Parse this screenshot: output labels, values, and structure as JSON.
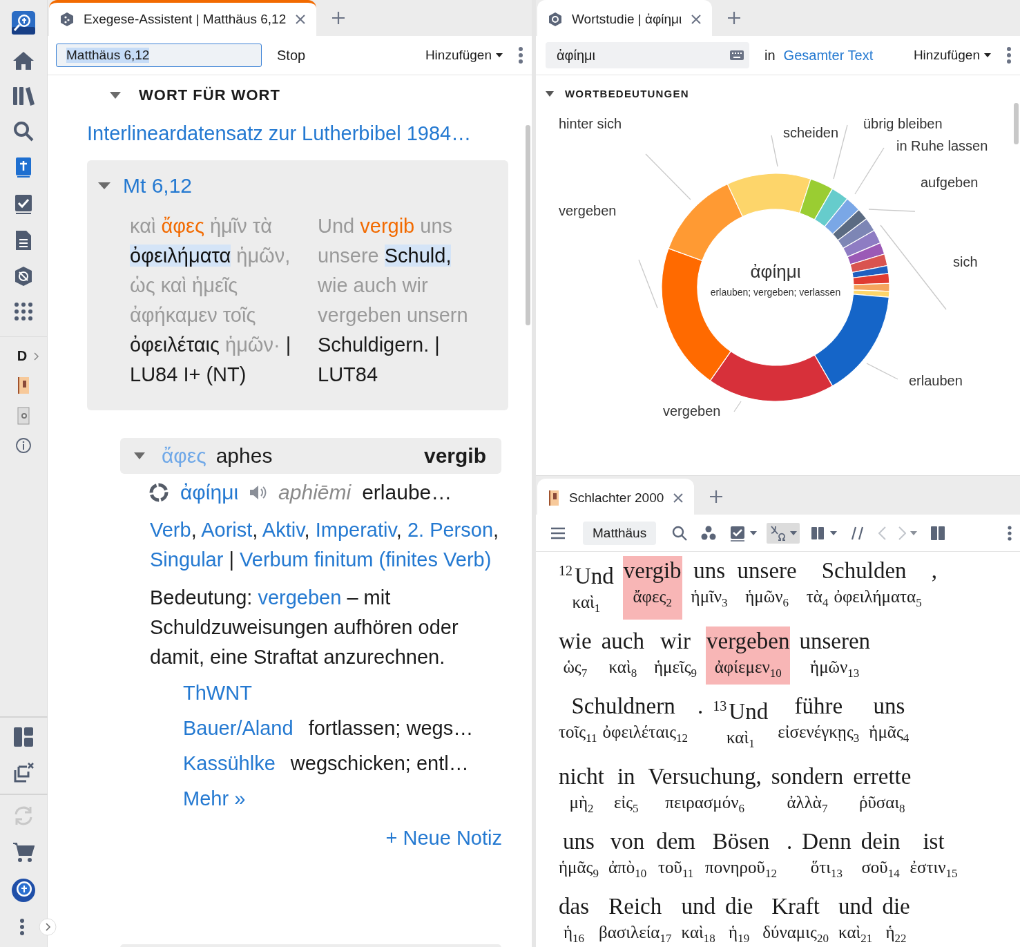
{
  "rail": {
    "letter": "D"
  },
  "left": {
    "tab": {
      "title": "Exegese-Assistent | Matthäus 6,12",
      "focused": true
    },
    "reference": "Matthäus 6,12",
    "stop": "Stop",
    "add": "Hinzufügen",
    "section": {
      "title": "WORT FÜR WORT",
      "expanded": true
    },
    "dataset_link": "Interlineardatensatz zur Lutherbibel 1984…",
    "verse": {
      "ref": "Mt 6,12",
      "expanded": true,
      "greek": [
        {
          "t": "καὶ",
          "kind": "muted"
        },
        {
          "t": "ἄφες",
          "kind": "focus"
        },
        {
          "t": "ἡμῖν",
          "kind": "muted"
        },
        {
          "t": "τὰ",
          "kind": "muted"
        },
        {
          "t": "ὀφειλήματα",
          "kind": "match"
        },
        {
          "t": "ἡμῶν,",
          "kind": "muted"
        },
        {
          "t": "ὡς",
          "kind": "muted"
        },
        {
          "t": "καὶ",
          "kind": "muted"
        },
        {
          "t": "ἡμεῖς",
          "kind": "muted"
        },
        {
          "t": "ἀφήκαμεν",
          "kind": "muted"
        },
        {
          "t": "τοῖς",
          "kind": "muted"
        },
        {
          "t": "ὀφειλέταις",
          "kind": "normal"
        },
        {
          "t": "ἡμῶν·",
          "kind": "muted"
        },
        {
          "t": "| LU84 I+ (NT)",
          "kind": "normal"
        }
      ],
      "german": [
        {
          "t": "Und",
          "kind": "muted"
        },
        {
          "t": "vergib",
          "kind": "focus"
        },
        {
          "t": "uns",
          "kind": "muted"
        },
        {
          "t": "unsere",
          "kind": "muted"
        },
        {
          "t": "Schuld,",
          "kind": "match"
        },
        {
          "t": "wie auch wir vergeben unsern",
          "kind": "muted"
        },
        {
          "t": "Schuldigern. | LUT84",
          "kind": "normal"
        }
      ]
    },
    "word": {
      "greek": "ἄφες",
      "translit": "aphes",
      "gloss": "vergib",
      "expanded": true
    },
    "lemma": {
      "word": "ἀφίημι",
      "translit": "aphiēmi",
      "gloss": "erlaube…"
    },
    "parsing": [
      {
        "kind": "link",
        "text": "Verb"
      },
      {
        "kind": "text",
        "text": ", "
      },
      {
        "kind": "link",
        "text": "Aorist"
      },
      {
        "kind": "text",
        "text": ", "
      },
      {
        "kind": "link",
        "text": "Aktiv"
      },
      {
        "kind": "text",
        "text": ", "
      },
      {
        "kind": "link",
        "text": "Imperativ"
      },
      {
        "kind": "text",
        "text": ", "
      },
      {
        "kind": "link",
        "text": "2. Person"
      },
      {
        "kind": "text",
        "text": ", "
      },
      {
        "kind": "link",
        "text": "Singular"
      },
      {
        "kind": "text",
        "text": " | "
      },
      {
        "kind": "link",
        "text": "Verbum finitum (finites Verb)"
      }
    ],
    "meaning": {
      "label": "Bedeutung:",
      "link": "vergeben",
      "rest": "– mit Schuldzuweisungen aufhören oder damit, eine Straftat anzurechnen."
    },
    "lexicons": [
      {
        "name": "ThWNT"
      },
      {
        "name": "Bauer/Aland",
        "gloss": "fortlassen; wegs…"
      },
      {
        "name": "Kassühlke",
        "gloss": "wegschicken; entl…"
      }
    ],
    "more": "Mehr »",
    "new_note": "+ Neue Notiz"
  },
  "right_top": {
    "tab": {
      "title": "Wortstudie | ἀφίημι",
      "focused": false
    },
    "search": "ἀφίημι",
    "in": "in",
    "scope": "Gesamter Text",
    "add": "Hinzufügen",
    "section": {
      "title": "WORTBEDEUTUNGEN",
      "expanded": true
    },
    "chart": {
      "center_word": "ἀφίημι",
      "center_gloss": "erlauben; vergeben; verlassen",
      "labels": [
        "hinter sich",
        "scheiden",
        "übrig bleiben",
        "in Ruhe lassen",
        "aufgeben",
        "vergeben",
        "sich",
        "erlauben",
        "vergeben"
      ]
    }
  },
  "right_bottom": {
    "tab": {
      "title": "Schlachter 2000",
      "focused": false
    },
    "book": "Matthäus",
    "toolbar": [
      {
        "kind": "menu",
        "selected": false,
        "disabled": false
      },
      {
        "kind": "book"
      },
      {
        "kind": "search",
        "selected": false,
        "disabled": false
      },
      {
        "kind": "cluster",
        "selected": false,
        "disabled": false
      },
      {
        "kind": "checklist",
        "selected": false,
        "disabled": false
      },
      {
        "kind": "interlinear",
        "selected": true,
        "disabled": false
      },
      {
        "kind": "columns",
        "selected": false,
        "disabled": false
      },
      {
        "kind": "parallel",
        "selected": false,
        "disabled": false
      },
      {
        "kind": "back",
        "selected": false,
        "disabled": true
      },
      {
        "kind": "forward",
        "selected": false,
        "disabled": true
      },
      {
        "kind": "panel",
        "selected": false,
        "disabled": false
      },
      {
        "kind": "more",
        "selected": false,
        "disabled": false
      }
    ],
    "rows": [
      {
        "cols": [
          {
            "verse": "12",
            "de": "Und",
            "gr": [
              {
                "w": "καὶ",
                "n": "1"
              }
            ],
            "highlighted": false
          },
          {
            "de": "vergib",
            "gr": [
              {
                "w": "ἄφες",
                "n": "2"
              }
            ],
            "highlighted": true
          },
          {
            "de": "uns",
            "gr": [
              {
                "w": "ἡμῖν",
                "n": "3"
              }
            ],
            "highlighted": false
          },
          {
            "de": "unsere",
            "gr": [
              {
                "w": "ἡμῶν",
                "n": "6"
              }
            ],
            "highlighted": false
          },
          {
            "de": "Schulden",
            "gr": [
              {
                "w": "τὰ",
                "n": "4"
              },
              {
                "w": "ὀφειλήματα",
                "n": "5"
              }
            ],
            "highlighted": false
          },
          {
            "de": ",",
            "highlighted": false
          }
        ]
      },
      {
        "cols": [
          {
            "de": "wie",
            "gr": [
              {
                "w": "ὡς",
                "n": "7"
              }
            ],
            "highlighted": false
          },
          {
            "de": "auch",
            "gr": [
              {
                "w": "καὶ",
                "n": "8"
              }
            ],
            "highlighted": false
          },
          {
            "de": "wir",
            "gr": [
              {
                "w": "ἡμεῖς",
                "n": "9"
              }
            ],
            "highlighted": false
          },
          {
            "de": "vergeben",
            "gr": [
              {
                "w": "ἀφίεμεν",
                "n": "10"
              }
            ],
            "highlighted": true
          },
          {
            "de": "unseren",
            "gr": [
              {
                "w": "ἡμῶν",
                "n": "13"
              }
            ],
            "highlighted": false
          }
        ]
      },
      {
        "cols": [
          {
            "de": "Schuldnern",
            "gr": [
              {
                "w": "τοῖς",
                "n": "11"
              },
              {
                "w": "ὀφειλέταις",
                "n": "12"
              }
            ],
            "highlighted": false
          },
          {
            "de": ".",
            "highlighted": false
          },
          {
            "verse": "13",
            "de": "Und",
            "gr": [
              {
                "w": "καὶ",
                "n": "1"
              }
            ],
            "highlighted": false
          },
          {
            "de": "führe",
            "gr": [
              {
                "w": "εἰσενέγκῃς",
                "n": "3"
              }
            ],
            "highlighted": false
          },
          {
            "de": "uns",
            "gr": [
              {
                "w": "ἡμᾶς",
                "n": "4"
              }
            ],
            "highlighted": false
          }
        ]
      },
      {
        "cols": [
          {
            "de": "nicht",
            "gr": [
              {
                "w": "μὴ",
                "n": "2"
              }
            ],
            "highlighted": false
          },
          {
            "de": "in",
            "gr": [
              {
                "w": "εἰς",
                "n": "5"
              }
            ],
            "highlighted": false
          },
          {
            "de": "Versuchung,",
            "gr": [
              {
                "w": "πειρασμόν",
                "n": "6"
              }
            ],
            "highlighted": false
          },
          {
            "de": "sondern",
            "gr": [
              {
                "w": "ἀλλὰ",
                "n": "7"
              }
            ],
            "highlighted": false
          },
          {
            "de": "errette",
            "gr": [
              {
                "w": "ῥῦσαι",
                "n": "8"
              }
            ],
            "highlighted": false
          }
        ]
      },
      {
        "cols": [
          {
            "de": "uns",
            "gr": [
              {
                "w": "ἡμᾶς",
                "n": "9"
              }
            ],
            "highlighted": false
          },
          {
            "de": "von",
            "gr": [
              {
                "w": "ἀπὸ",
                "n": "10"
              }
            ],
            "highlighted": false
          },
          {
            "de": "dem",
            "gr": [
              {
                "w": "τοῦ",
                "n": "11"
              }
            ],
            "highlighted": false
          },
          {
            "de": "Bösen",
            "gr": [
              {
                "w": "πονηροῦ",
                "n": "12"
              }
            ],
            "highlighted": false
          },
          {
            "de": ".",
            "highlighted": false
          },
          {
            "de": "Denn",
            "gr": [
              {
                "w": "ὅτι",
                "n": "13"
              }
            ],
            "highlighted": false
          },
          {
            "de": "dein",
            "gr": [
              {
                "w": "σοῦ",
                "n": "14"
              }
            ],
            "highlighted": false
          },
          {
            "de": "ist",
            "gr": [
              {
                "w": "ἐστιν",
                "n": "15"
              }
            ],
            "highlighted": false
          }
        ]
      },
      {
        "cols": [
          {
            "de": "das",
            "gr": [
              {
                "w": "ἡ",
                "n": "16"
              }
            ],
            "highlighted": false
          },
          {
            "de": "Reich",
            "gr": [
              {
                "w": "βασιλεία",
                "n": "17"
              }
            ],
            "highlighted": false
          },
          {
            "de": "und",
            "gr": [
              {
                "w": "καὶ",
                "n": "18"
              }
            ],
            "highlighted": false
          },
          {
            "de": "die",
            "gr": [
              {
                "w": "ἡ",
                "n": "19"
              }
            ],
            "highlighted": false
          },
          {
            "de": "Kraft",
            "gr": [
              {
                "w": "δύναμις",
                "n": "20"
              }
            ],
            "highlighted": false
          },
          {
            "de": "und",
            "gr": [
              {
                "w": "καὶ",
                "n": "21"
              }
            ],
            "highlighted": false
          },
          {
            "de": "die",
            "gr": [
              {
                "w": "ἡ",
                "n": "22"
              }
            ],
            "highlighted": false
          }
        ]
      }
    ]
  }
}
